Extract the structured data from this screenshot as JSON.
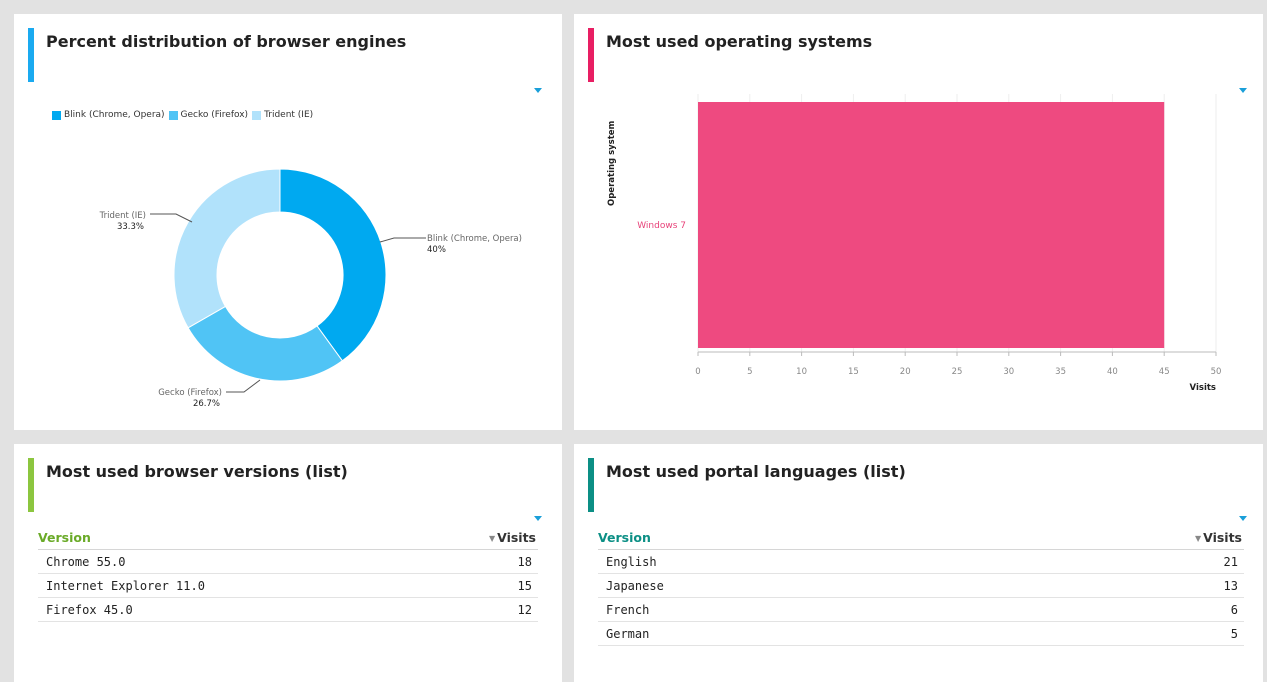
{
  "colors": {
    "blink": "#00a9f0",
    "gecko": "#50c4f5",
    "trident": "#b1e2fb",
    "os_bar": "#ee4a80",
    "accent_blue": "#1aaaf0",
    "accent_pink": "#e81e63",
    "accent_green": "#8cc63f",
    "accent_teal": "#0c8f85",
    "header_green": "#6aaa28",
    "header_teal": "#0c8f85"
  },
  "panels": {
    "engines": {
      "title": "Percent distribution of browser engines",
      "legend": [
        "Blink (Chrome, Opera)",
        "Gecko (Firefox)",
        "Trident (IE)"
      ],
      "labels": [
        {
          "name": "Blink (Chrome, Opera)",
          "pct": "40%"
        },
        {
          "name": "Gecko (Firefox)",
          "pct": "26.7%"
        },
        {
          "name": "Trident (IE)",
          "pct": "33.3%"
        }
      ]
    },
    "os": {
      "title": "Most used operating systems",
      "y_axis_label": "Operating system",
      "x_axis_label": "Visits",
      "category": "Windows 7"
    },
    "browsers": {
      "title": "Most used browser versions (list)",
      "col_version": "Version",
      "col_visits": "Visits",
      "rows": [
        {
          "name": "Chrome 55.0",
          "visits": "18"
        },
        {
          "name": "Internet Explorer 11.0",
          "visits": "15"
        },
        {
          "name": "Firefox 45.0",
          "visits": "12"
        }
      ]
    },
    "languages": {
      "title": "Most used portal languages (list)",
      "col_version": "Version",
      "col_visits": "Visits",
      "rows": [
        {
          "name": "English",
          "visits": "21"
        },
        {
          "name": "Japanese",
          "visits": "13"
        },
        {
          "name": "French",
          "visits": "6"
        },
        {
          "name": "German",
          "visits": "5"
        }
      ]
    }
  },
  "chart_data": [
    {
      "type": "pie",
      "title": "Percent distribution of browser engines",
      "categories": [
        "Blink (Chrome, Opera)",
        "Gecko (Firefox)",
        "Trident (IE)"
      ],
      "values": [
        40,
        26.7,
        33.3
      ],
      "legend": "top-left",
      "donut": true
    },
    {
      "type": "bar",
      "orientation": "horizontal",
      "title": "Most used operating systems",
      "categories": [
        "Windows 7"
      ],
      "values": [
        45
      ],
      "xlabel": "Visits",
      "ylabel": "Operating system",
      "xlim": [
        0,
        50
      ],
      "xticks": [
        "0",
        "5",
        "10",
        "15",
        "20",
        "25",
        "30",
        "35",
        "40",
        "45",
        "50"
      ],
      "grid": true
    }
  ]
}
